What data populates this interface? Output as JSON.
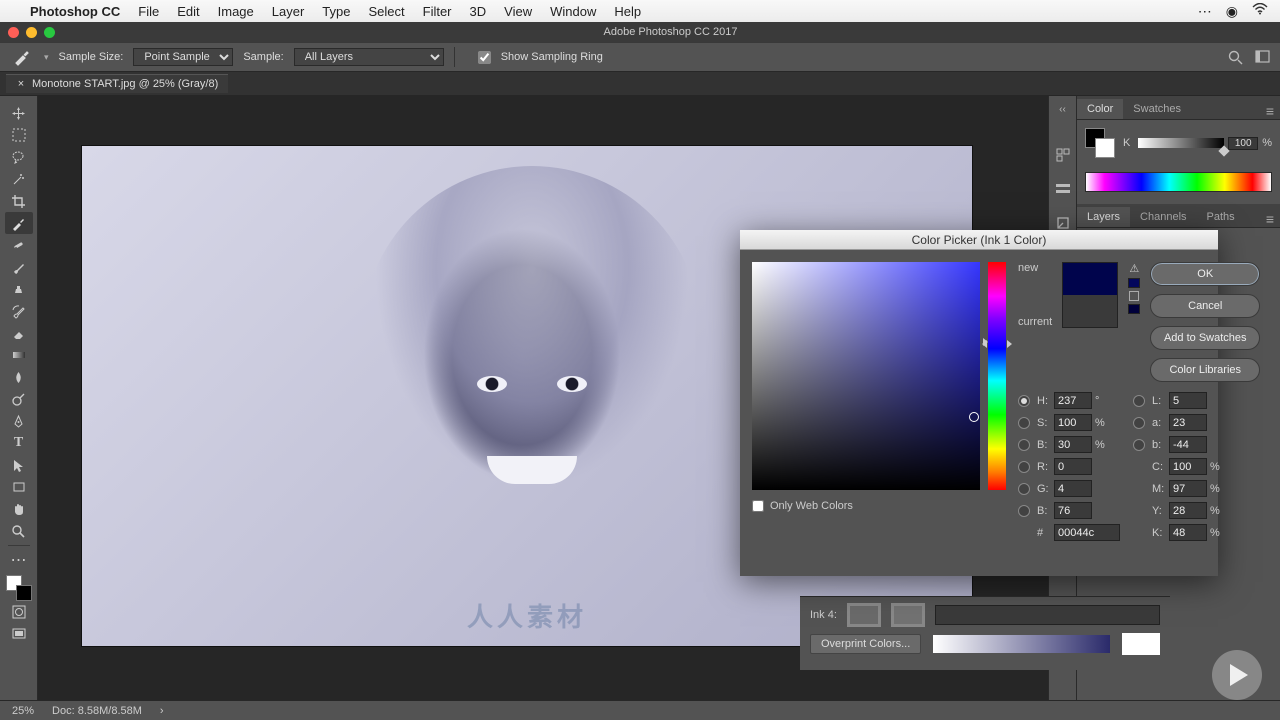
{
  "mac_menu": {
    "app": "Photoshop CC",
    "items": [
      "File",
      "Edit",
      "Image",
      "Layer",
      "Type",
      "Select",
      "Filter",
      "3D",
      "View",
      "Window",
      "Help"
    ]
  },
  "window_title": "Adobe Photoshop CC 2017",
  "options_bar": {
    "sample_size_label": "Sample Size:",
    "sample_size_value": "Point Sample",
    "sample_label": "Sample:",
    "sample_value": "All Layers",
    "show_ring_label": "Show Sampling Ring"
  },
  "doc_tab": {
    "name": "Monotone START.jpg @ 25% (Gray/8)"
  },
  "panels": {
    "color_tab": "Color",
    "swatches_tab": "Swatches",
    "k_label": "K",
    "k_value": "100",
    "k_unit": "%",
    "layers_tab": "Layers",
    "channels_tab": "Channels",
    "paths_tab": "Paths"
  },
  "color_picker": {
    "title": "Color Picker (Ink 1 Color)",
    "new_label": "new",
    "current_label": "current",
    "ok": "OK",
    "cancel": "Cancel",
    "add_swatches": "Add to Swatches",
    "color_libraries": "Color Libraries",
    "owc_label": "Only Web Colors",
    "hex_label": "#",
    "hex_value": "00044c",
    "fields": {
      "H_label": "H:",
      "H": "237",
      "H_unit": "°",
      "S_label": "S:",
      "S": "100",
      "S_unit": "%",
      "B_label": "B:",
      "B": "30",
      "B_unit": "%",
      "R_label": "R:",
      "R": "0",
      "G_label": "G:",
      "G": "4",
      "Bch_label": "B:",
      "Bch": "76",
      "L_label": "L:",
      "L": "5",
      "a_label": "a:",
      "a": "23",
      "b_label": "b:",
      "b": "-44",
      "C_label": "C:",
      "C": "100",
      "C_unit": "%",
      "M_label": "M:",
      "M": "97",
      "M_unit": "%",
      "Y_label": "Y:",
      "Y": "28",
      "Y_unit": "%",
      "K_label": "K:",
      "K": "48",
      "K_unit": "%"
    }
  },
  "ink_panel": {
    "ink4_label": "Ink 4:",
    "overprint_btn": "Overprint Colors..."
  },
  "status": {
    "zoom": "25%",
    "docsize": "Doc: 8.58M/8.58M"
  },
  "watermark": "人人素材"
}
